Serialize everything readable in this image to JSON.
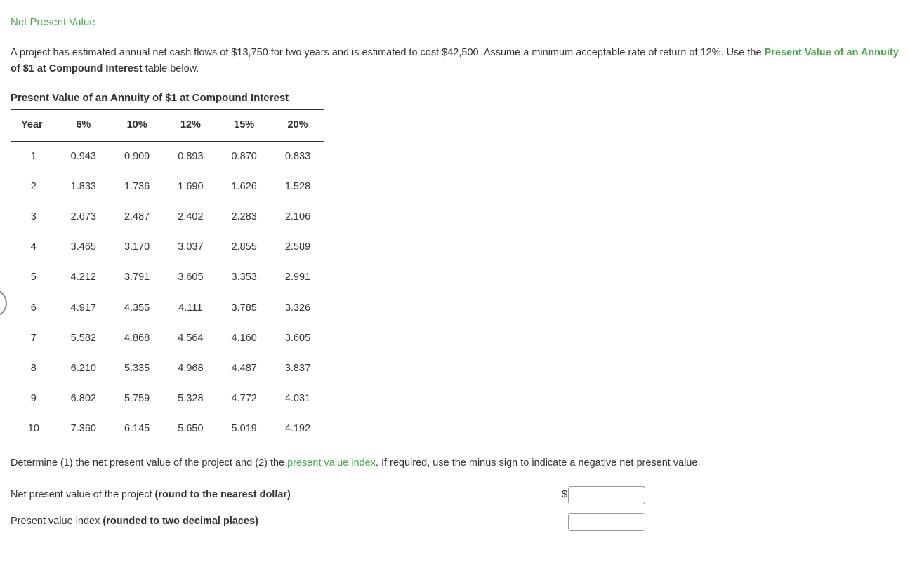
{
  "title": "Net Present Value",
  "intro": {
    "part1": "A project has estimated annual net cash flows of $13,750 for two years and is estimated to cost $42,500. Assume a minimum acceptable rate of return of 12%. Use the ",
    "link": "Present Value of an Annuity",
    "part2": " of $1 at Compound Interest",
    "part3": " table below."
  },
  "tableTitle": "Present Value of an Annuity of $1 at Compound Interest",
  "headers": [
    "Year",
    "6%",
    "10%",
    "12%",
    "15%",
    "20%"
  ],
  "rows": [
    [
      "1",
      "0.943",
      "0.909",
      "0.893",
      "0.870",
      "0.833"
    ],
    [
      "2",
      "1.833",
      "1.736",
      "1.690",
      "1.626",
      "1.528"
    ],
    [
      "3",
      "2.673",
      "2.487",
      "2.402",
      "2.283",
      "2.106"
    ],
    [
      "4",
      "3.465",
      "3.170",
      "3.037",
      "2.855",
      "2.589"
    ],
    [
      "5",
      "4.212",
      "3.791",
      "3.605",
      "3.353",
      "2.991"
    ],
    [
      "6",
      "4.917",
      "4.355",
      "4.111",
      "3.785",
      "3.326"
    ],
    [
      "7",
      "5.582",
      "4.868",
      "4.564",
      "4.160",
      "3.605"
    ],
    [
      "8",
      "6.210",
      "5.335",
      "4.968",
      "4.487",
      "3.837"
    ],
    [
      "9",
      "6.802",
      "5.759",
      "5.328",
      "4.772",
      "4.031"
    ],
    [
      "10",
      "7.360",
      "6.145",
      "5.650",
      "5.019",
      "4.192"
    ]
  ],
  "instruct": {
    "part1": "Determine (1) the net present value of the project and (2) the ",
    "link": "present value index",
    "part2": ". If required, use the minus sign to indicate a negative net present value."
  },
  "answers": {
    "npv": {
      "label": "Net present value of the project ",
      "bold": "(round to the nearest dollar)",
      "prefix": "$"
    },
    "pvi": {
      "label": "Present value index ",
      "bold": "(rounded to two decimal places)"
    }
  }
}
